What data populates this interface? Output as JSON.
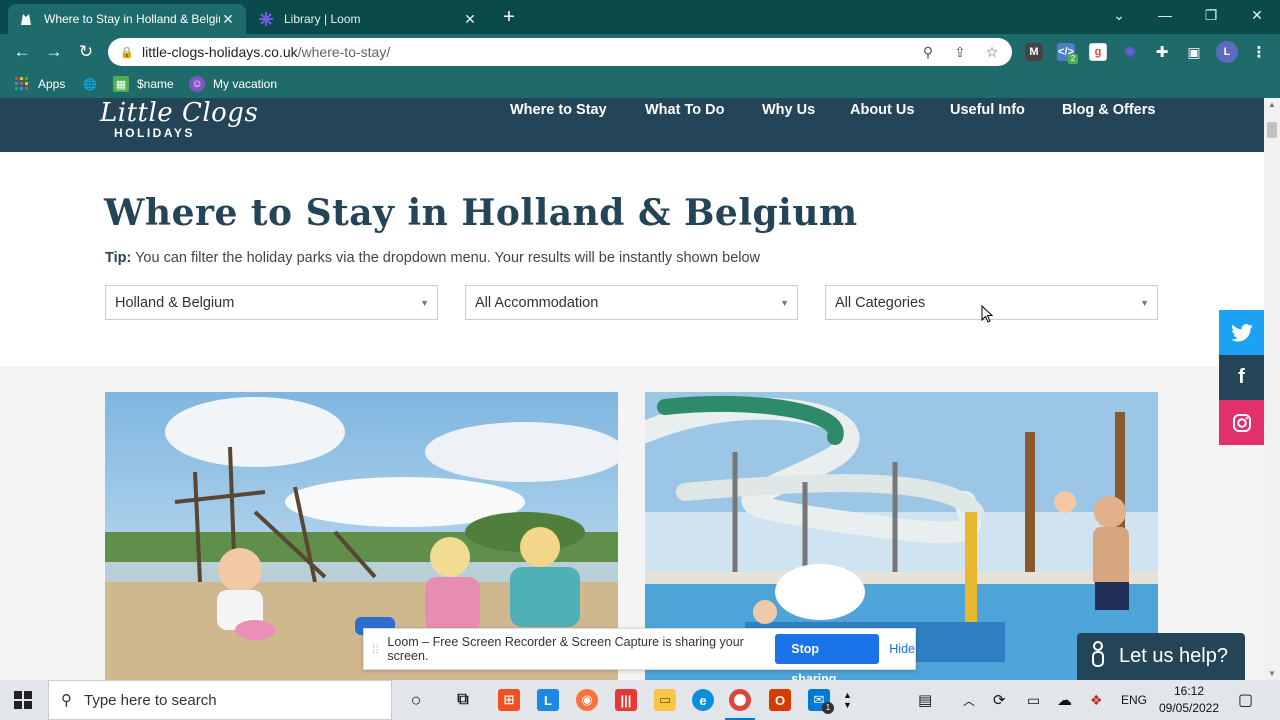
{
  "browser": {
    "tabs": [
      {
        "title": "Where to Stay in Holland & Belgium | Little Clogs Holidays",
        "active": true
      },
      {
        "title": "Library | Loom",
        "active": false
      }
    ],
    "url_host": "little-clogs-holidays.co.uk",
    "url_path": "/where-to-stay/",
    "bookmarks": [
      {
        "label": "Apps"
      },
      {
        "label": ""
      },
      {
        "label": "$name"
      },
      {
        "label": "My vacation"
      }
    ],
    "profile_initial": "L",
    "extension_badge": "2"
  },
  "site": {
    "logo_line1": "Little Clogs",
    "logo_line2": "HOLIDAYS",
    "nav": [
      "Where to Stay",
      "What To Do",
      "Why Us",
      "About Us",
      "Useful Info",
      "Blog & Offers"
    ],
    "page_title": "Where to Stay in Holland & Belgium",
    "tip_label": "Tip:",
    "tip_text": " You can filter the holiday parks via the dropdown menu. Your results will be instantly shown below",
    "filters": [
      {
        "selected": "Holland & Belgium"
      },
      {
        "selected": "All Accommodation"
      },
      {
        "selected": "All Categories"
      }
    ],
    "social": [
      {
        "name": "twitter",
        "color": "#1da1f2"
      },
      {
        "name": "facebook",
        "color": "#244457"
      },
      {
        "name": "instagram",
        "color": "#e1306c"
      }
    ],
    "chat_label": "Let us help?"
  },
  "loom": {
    "message": "Loom – Free Screen Recorder & Screen Capture is sharing your screen.",
    "stop_label": "Stop sharing",
    "hide_label": "Hide"
  },
  "taskbar": {
    "search_placeholder": "Type here to search",
    "language": "ENG",
    "time": "16:12",
    "date": "09/05/2022",
    "mail_badge": "1"
  },
  "colors": {
    "tab_bar": "#0b4a4a",
    "toolbar": "#1f6b6b",
    "site_nav": "#244457",
    "accent": "#1a73e8"
  }
}
